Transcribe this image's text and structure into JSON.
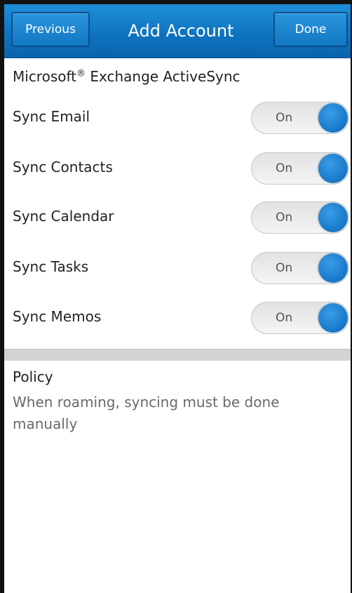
{
  "header": {
    "title": "Add Account",
    "previous_label": "Previous",
    "done_label": "Done"
  },
  "account_type": {
    "name": "Microsoft",
    "mark": "®",
    "suffix": " Exchange ActiveSync"
  },
  "sync_options": [
    {
      "label": "Sync Email",
      "state": "On"
    },
    {
      "label": "Sync Contacts",
      "state": "On"
    },
    {
      "label": "Sync Calendar",
      "state": "On"
    },
    {
      "label": "Sync Tasks",
      "state": "On"
    },
    {
      "label": "Sync Memos",
      "state": "On"
    }
  ],
  "policy": {
    "title": "Policy",
    "text": "When roaming, syncing must be done manually"
  },
  "colors": {
    "title_bar": "#0f74c0",
    "toggle_knob": "#1677c8"
  }
}
